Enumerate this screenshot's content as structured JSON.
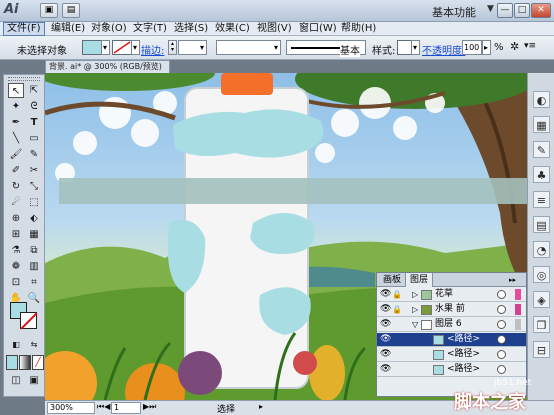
{
  "app": {
    "logo_text": "Ai",
    "workspace": "基本功能",
    "win_minimize": "—",
    "win_restore": "□",
    "win_close": "✕"
  },
  "menu": [
    "文件(F)",
    "编辑(E)",
    "对象(O)",
    "文字(T)",
    "选择(S)",
    "效果(C)",
    "视图(V)",
    "窗口(W)",
    "帮助(H)"
  ],
  "control": {
    "no_selection": "未选择对象",
    "stroke_label": "描边:",
    "brush_label": "基本",
    "style_label": "样式:",
    "opacity_label": "不透明度:",
    "opacity_value": "100",
    "percent": "%",
    "fill_color": "#a9dde4"
  },
  "document": {
    "tab_title": "背景. ai* @ 300% (RGB/预览)"
  },
  "status": {
    "zoom": "300%",
    "page": "1",
    "tool": "选择"
  },
  "layers_panel": {
    "tabs": [
      "画板",
      "图层"
    ],
    "rows": [
      {
        "name": "花草",
        "color": "#e84c9c",
        "thumb": "#9dc79a"
      },
      {
        "name": "水果 前",
        "color": "#d5418e",
        "thumb": "#7a9a3a"
      },
      {
        "name": "图层 6",
        "color": "#c0c0c0",
        "thumb": "#ffffff"
      },
      {
        "name": "<路径>",
        "color": "#c0c0c0",
        "thumb": "#a9dde4"
      },
      {
        "name": "<路径>",
        "color": "#c0c0c0",
        "thumb": "#a9dde4"
      },
      {
        "name": "<路径>",
        "color": "#c0c0c0",
        "thumb": "#a9dde4"
      }
    ]
  },
  "watermark": {
    "site": "jb51.net",
    "text": "脚本之家"
  }
}
